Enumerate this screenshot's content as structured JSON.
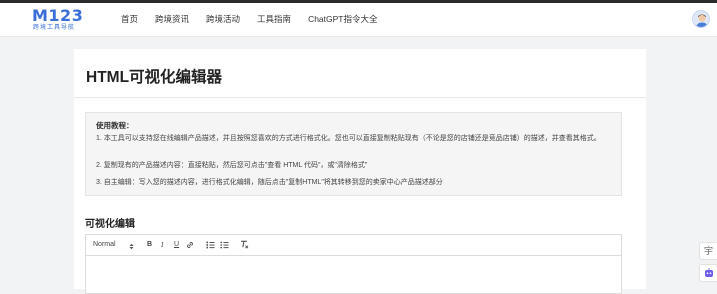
{
  "logo": {
    "mark": "M123",
    "subtitle": "跨境工具导航"
  },
  "nav": {
    "items": [
      "首页",
      "跨境资讯",
      "跨境活动",
      "工具指南",
      "ChatGPT指令大全"
    ]
  },
  "page": {
    "title": "HTML可视化编辑器"
  },
  "tutorial": {
    "title": "使用教程：",
    "steps": [
      "1. 本工具可以支持您在线编辑产品描述，并且按照您喜欢的方式进行格式化。您也可以直接复制粘贴现有（不论是您的店铺还是竞品店铺）的描述，并查看其格式。",
      "2. 复制现有的产品描述内容：直接粘贴，然后您可点击\"查看 HTML 代码\"，或\"清除格式\"",
      "3. 自主编辑：写入您的描述内容，进行格式化编辑，随后点击\"复制HTML\"将其转移到您的卖家中心产品描述部分"
    ]
  },
  "editor": {
    "section_title": "可视化编辑",
    "format_select": "Normal",
    "bold": "B",
    "italic": "I",
    "underline": "U"
  },
  "side_tools": {
    "top_glyph": "宇"
  },
  "colors": {
    "brand": "#3a6fd8",
    "page_bg": "#f2f3f5"
  }
}
